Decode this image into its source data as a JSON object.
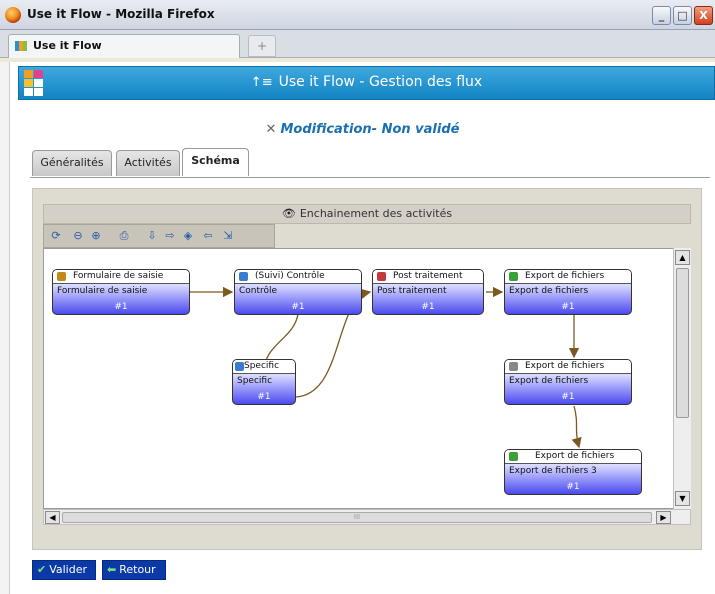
{
  "window": {
    "title": "Use it Flow - Mozilla Firefox",
    "minimize": "_",
    "maximize": "□",
    "close": "X"
  },
  "browser_tab": {
    "label": "Use it Flow",
    "new_tab": "+"
  },
  "app": {
    "header_title": "Use it Flow - Gestion des flux",
    "subtitle": "Modification- Non validé",
    "tabs": [
      {
        "label": "Généralités",
        "active": false
      },
      {
        "label": "Activités",
        "active": false
      },
      {
        "label": "Schéma",
        "active": true
      }
    ]
  },
  "schema": {
    "panel_title": "Enchainement des activités",
    "toolbar": [
      "refresh-icon",
      "zoom-out-icon",
      "zoom-in-icon",
      "print-icon",
      "import-icon",
      "export-icon",
      "tool1-icon",
      "tool2-icon",
      "tool3-icon"
    ],
    "nodes": [
      {
        "id": "n1",
        "title": "Formulaire de saisie",
        "name": "Formulaire de saisie",
        "count": "#1",
        "icon_color": "#c08a1a"
      },
      {
        "id": "n2",
        "title": "(Suivi) Contrôle",
        "name": "Contrôle",
        "count": "#1",
        "icon_color": "#3a7cd0"
      },
      {
        "id": "n3",
        "title": "Post traitement",
        "name": "Post traitement",
        "count": "#1",
        "icon_color": "#c03a3a"
      },
      {
        "id": "n4",
        "title": "Export de fichiers",
        "name": "Export de fichiers",
        "count": "#1",
        "icon_color": "#3aa03a"
      },
      {
        "id": "n5",
        "title": "Specific",
        "name": "Specific",
        "count": "#1",
        "icon_color": "#3a7cd0"
      },
      {
        "id": "n6",
        "title": "Export de fichiers",
        "name": "Export de fichiers",
        "count": "#1",
        "icon_color": "#888888"
      },
      {
        "id": "n7",
        "title": "Export de fichiers",
        "name": "Export de fichiers 3",
        "count": "#1",
        "icon_color": "#3aa03a"
      }
    ],
    "scroll_hint": "III"
  },
  "buttons": {
    "validate": "Valider",
    "back": "Retour"
  },
  "colors": {
    "header_blue": "#1284c2",
    "node_fill": "#4b4bf0",
    "edge": "#7a5a20",
    "button": "#0b3aa8"
  }
}
